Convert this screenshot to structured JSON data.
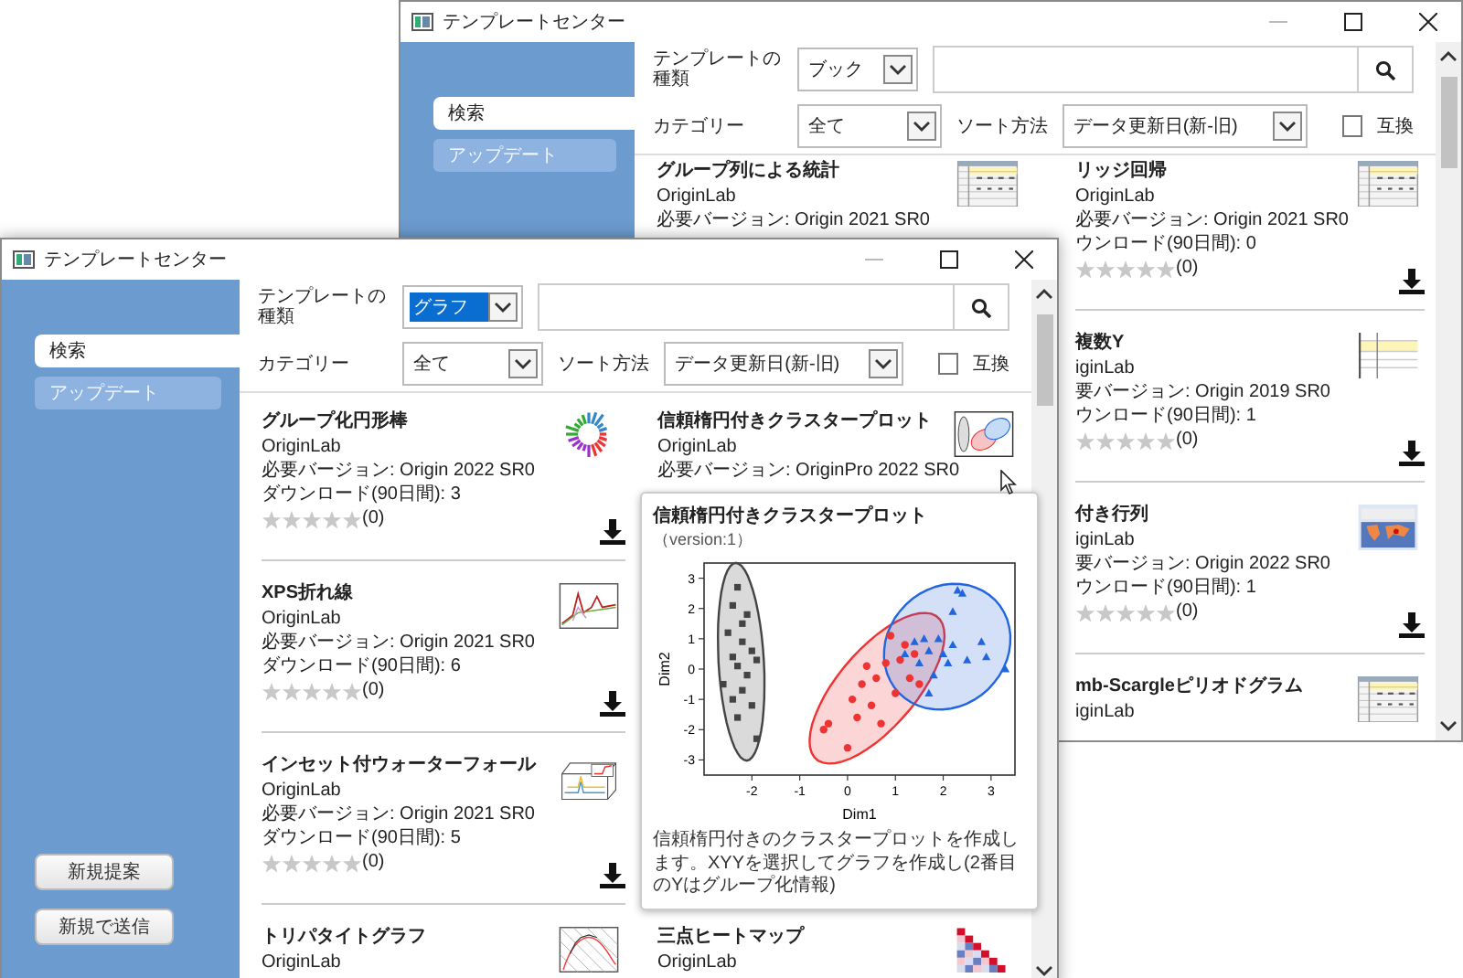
{
  "windows": [
    {
      "title": "テンプレートセンター",
      "sidebar": {
        "items": [
          {
            "label": "検索",
            "selected": true
          },
          {
            "label": "アップデート",
            "selected": false
          }
        ]
      },
      "toolbar": {
        "type_label": "テンプレートの種類",
        "type_value": "ブック",
        "type_highlighted": false,
        "category_label": "カテゴリー",
        "category_value": "全て",
        "sort_label": "ソート方法",
        "sort_value": "データ更新日(新-旧)",
        "compat": {
          "label": "互換",
          "checked": false
        }
      },
      "rows": [
        {
          "left": {
            "title": "グループ列による統計",
            "author": "OriginLab",
            "version": "必要バージョン: Origin 2021 SR0",
            "thumbnail": {
              "kind": "table"
            }
          },
          "right": {
            "title": "リッジ回帰",
            "author": "OriginLab",
            "version": "必要バージョン: Origin 2021 SR0",
            "downloads": "ウンロード(90日間): 0",
            "stars": 0,
            "rating_count": "(0)",
            "thumbnail": {
              "kind": "table"
            }
          }
        },
        {
          "right": {
            "title": "複数Y",
            "author": "iginLab",
            "version": "要バージョン: Origin 2019 SR0",
            "downloads": "ウンロード(90日間): 1",
            "stars": 0,
            "rating_count": "(0)",
            "thumbnail": {
              "kind": "sheet"
            }
          }
        },
        {
          "right": {
            "title": "付き行列",
            "author": "iginLab",
            "version": "要バージョン: Origin 2022 SR0",
            "downloads": "ウンロード(90日間): 1",
            "stars": 0,
            "rating_count": "(0)",
            "thumbnail": {
              "kind": "map"
            }
          }
        },
        {
          "right": {
            "title": "mb-Scargleピリオドグラム",
            "author": "iginLab",
            "thumbnail": {
              "kind": "table"
            }
          }
        }
      ]
    },
    {
      "title": "テンプレートセンター",
      "sidebar": {
        "items": [
          {
            "label": "検索",
            "selected": true
          },
          {
            "label": "アップデート",
            "selected": false
          }
        ],
        "buttons": [
          "新規提案",
          "新規で送信"
        ]
      },
      "toolbar": {
        "type_label": "テンプレートの種類",
        "type_value": "グラフ",
        "type_highlighted": true,
        "category_label": "カテゴリー",
        "category_value": "全て",
        "sort_label": "ソート方法",
        "sort_value": "データ更新日(新-旧)",
        "compat": {
          "label": "互換",
          "checked": false
        }
      },
      "rows": [
        {
          "left": {
            "title": "グループ化円形棒",
            "author": "OriginLab",
            "version": "必要バージョン: Origin 2022 SR0",
            "downloads": "ダウンロード(90日間): 3",
            "stars": 0,
            "rating_count": "(0)",
            "thumbnail": {
              "kind": "circular-bar"
            }
          },
          "right": {
            "title": "信頼楕円付きクラスタープロット",
            "author": "OriginLab",
            "version": "必要バージョン: OriginPro 2022 SR0",
            "thumbnail": {
              "kind": "cluster"
            }
          }
        },
        {
          "left": {
            "title": "XPS折れ線",
            "author": "OriginLab",
            "version": "必要バージョン: Origin 2021 SR0",
            "downloads": "ダウンロード(90日間): 6",
            "stars": 0,
            "rating_count": "(0)",
            "thumbnail": {
              "kind": "peaks"
            }
          }
        },
        {
          "left": {
            "title": "インセット付ウォーターフォール",
            "author": "OriginLab",
            "version": "必要バージョン: Origin 2021 SR0",
            "downloads": "ダウンロード(90日間): 5",
            "stars": 0,
            "rating_count": "(0)",
            "thumbnail": {
              "kind": "waterfall"
            }
          }
        },
        {
          "left": {
            "title": "トリパタイトグラフ",
            "author": "OriginLab",
            "thumbnail": {
              "kind": "tripartite"
            }
          },
          "right": {
            "title": "三点ヒートマップ",
            "author": "OriginLab",
            "thumbnail": {
              "kind": "heatmap"
            }
          }
        }
      ],
      "tooltip": {
        "title": "信頼楕円付きクラスタープロット",
        "version": "（version:1）",
        "description": "信頼楕円付きのクラスタープロットを作成します。XYYを選択してグラフを作成し(2番目のYはグループ化情報)",
        "chart_data": {
          "type": "scatter",
          "xlabel": "Dim1",
          "ylabel": "Dim2",
          "xlim": [
            -3,
            3.5
          ],
          "ylim": [
            -3.5,
            3.5
          ],
          "xticks": [
            -2,
            -1,
            0,
            1,
            2,
            3
          ],
          "yticks": [
            -3,
            -2,
            -1,
            0,
            1,
            2,
            3
          ],
          "series": [
            {
              "color": "#444444",
              "marker": "square",
              "x": [
                -2.3,
                -2.4,
                -2.1,
                -2.5,
                -2.2,
                -2.0,
                -2.4,
                -2.3,
                -2.1,
                -2.6,
                -2.2,
                -2.4,
                -2.0,
                -2.3,
                -1.9,
                -2.2,
                -1.9
              ],
              "values": [
                2.7,
                2.1,
                1.8,
                1.2,
                0.9,
                0.6,
                0.4,
                0.1,
                -0.2,
                -0.5,
                -0.7,
                -1.0,
                -1.2,
                -1.6,
                -2.3,
                1.5,
                0.3
              ]
            },
            {
              "color": "#ee3333",
              "marker": "circle",
              "x": [
                -0.5,
                -0.4,
                0.0,
                0.2,
                0.1,
                0.3,
                0.5,
                0.6,
                0.8,
                0.7,
                1.0,
                1.1,
                1.3,
                1.2,
                0.9,
                1.5,
                0.4,
                1.4
              ],
              "values": [
                -2.0,
                -1.8,
                -2.6,
                -1.6,
                -1.0,
                -0.5,
                -1.2,
                -0.3,
                0.2,
                -1.8,
                -0.8,
                0.3,
                -0.3,
                0.8,
                1.1,
                -0.5,
                0.1,
                0.5
              ]
            },
            {
              "color": "#2266dd",
              "marker": "triangle",
              "x": [
                1.2,
                1.4,
                1.5,
                1.7,
                1.8,
                1.9,
                2.0,
                2.2,
                2.3,
                2.4,
                2.2,
                2.5,
                2.8,
                2.9,
                3.3,
                1.6,
                2.1,
                1.7
              ],
              "values": [
                0.5,
                0.9,
                0.2,
                0.6,
                -0.2,
                1.0,
                0.5,
                0.8,
                2.6,
                2.5,
                1.9,
                0.3,
                0.9,
                0.4,
                0.0,
                1.0,
                0.2,
                -0.8
              ]
            }
          ]
        }
      }
    }
  ]
}
